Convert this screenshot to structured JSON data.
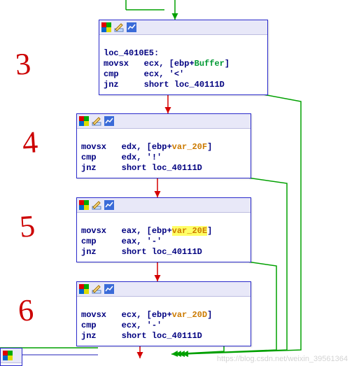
{
  "annotations": {
    "n3": "3",
    "n4": "4",
    "n5": "5",
    "n6": "6"
  },
  "nodes": {
    "b3": {
      "label": "loc_4010E5:",
      "l1_op": "movsx",
      "l1_reg": "ecx",
      "l1_prefix": ", [ebp+",
      "l1_sym": "Buffer",
      "l1_suffix": "]",
      "l2_op": "cmp",
      "l2_reg": "ecx",
      "l2_lit": ", '<'",
      "l3_op": "jnz",
      "l3_tgt": "short loc_40111D"
    },
    "b4": {
      "l1_op": "movsx",
      "l1_reg": "edx",
      "l1_prefix": ", [ebp+",
      "l1_sym": "var_20F",
      "l1_suffix": "]",
      "l2_op": "cmp",
      "l2_reg": "edx",
      "l2_lit": ", '!'",
      "l3_op": "jnz",
      "l3_tgt": "short loc_40111D"
    },
    "b5": {
      "l1_op": "movsx",
      "l1_reg": "eax",
      "l1_prefix": ", [ebp+",
      "l1_sym": "var_20E",
      "l1_suffix": "]",
      "l2_op": "cmp",
      "l2_reg": "eax",
      "l2_lit": ", '-'",
      "l3_op": "jnz",
      "l3_tgt": "short loc_40111D"
    },
    "b6": {
      "l1_op": "movsx",
      "l1_reg": "ecx",
      "l1_prefix": ", [ebp+",
      "l1_sym": "var_20D",
      "l1_suffix": "]",
      "l2_op": "cmp",
      "l2_reg": "ecx",
      "l2_lit": ", '-'",
      "l3_op": "jnz",
      "l3_tgt": "short loc_40111D"
    }
  },
  "watermark": "https://blog.csdn.net/weixin_39561364"
}
